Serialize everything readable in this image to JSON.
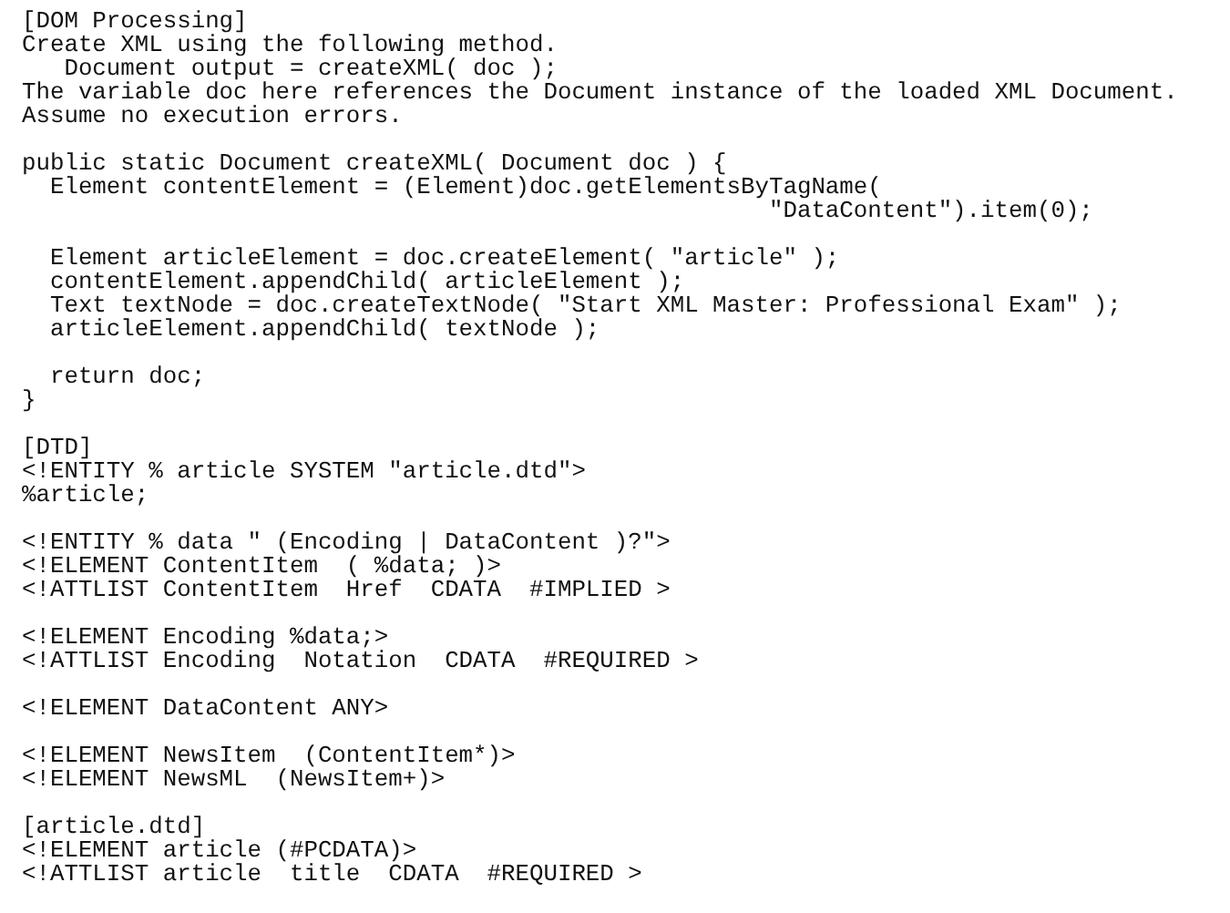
{
  "blocks": [
    {
      "lines": [
        "[DOM Processing]",
        "Create XML using the following method.",
        "   Document output = createXML( doc );",
        "The variable doc here references the Document instance of the loaded XML Document.",
        "Assume no execution errors."
      ]
    },
    {
      "lines": [
        "public static Document createXML( Document doc ) {",
        "  Element contentElement = (Element)doc.getElementsByTagName(",
        "                                                     \"DataContent\").item(0);"
      ]
    },
    {
      "lines": [
        "  Element articleElement = doc.createElement( \"article\" );",
        "  contentElement.appendChild( articleElement );",
        "  Text textNode = doc.createTextNode( \"Start XML Master: Professional Exam\" );",
        "  articleElement.appendChild( textNode );"
      ]
    },
    {
      "lines": [
        "  return doc;",
        "}"
      ]
    },
    {
      "lines": [
        "[DTD]",
        "<!ENTITY % article SYSTEM \"article.dtd\">",
        "%article;"
      ]
    },
    {
      "lines": [
        "<!ENTITY % data \" (Encoding | DataContent )?\">",
        "<!ELEMENT ContentItem  ( %data; )>",
        "<!ATTLIST ContentItem  Href  CDATA  #IMPLIED >"
      ]
    },
    {
      "lines": [
        "<!ELEMENT Encoding %data;>",
        "<!ATTLIST Encoding  Notation  CDATA  #REQUIRED >"
      ]
    },
    {
      "lines": [
        "<!ELEMENT DataContent ANY>"
      ]
    },
    {
      "lines": [
        "<!ELEMENT NewsItem  (ContentItem*)>",
        "<!ELEMENT NewsML  (NewsItem+)>"
      ]
    },
    {
      "lines": [
        "[article.dtd]",
        "<!ELEMENT article (#PCDATA)>",
        "<!ATTLIST article  title  CDATA  #REQUIRED >"
      ]
    }
  ]
}
